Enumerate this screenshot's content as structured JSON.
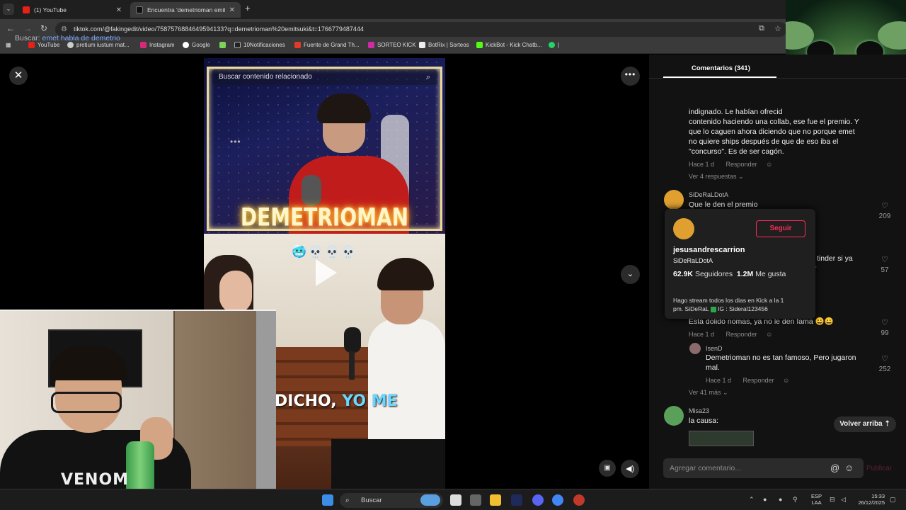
{
  "browser": {
    "tabs": [
      {
        "label": "(1) YouTube",
        "close": "✕"
      },
      {
        "label": "Encuentra 'demetrioman emits",
        "close": "✕"
      }
    ],
    "new_tab": "+",
    "url": "tiktok.com/@fakingedit/video/7587576884649594133?q=demetrioman%20emitsuki&t=1766779487444",
    "bookmarks": [
      "YouTube",
      "pretium iustum mat...",
      "Instagram",
      "Google",
      "10Notificaciones",
      "Fuente de Grand Th...",
      "SORTEO KICK",
      "BotRix | Sorteos",
      "KickBot - Kick Chatb..."
    ]
  },
  "video": {
    "search_placeholder": "Buscar contenido relacionado",
    "top_caption": "DEMETRIOMAN",
    "emoji_row": "🥶💀💀💀",
    "subtitle_white": "DICHO, ",
    "subtitle_highlight": "YO ME"
  },
  "webcam": {
    "shirt_text": "VENOM"
  },
  "comments": {
    "tab_title": "Comentarios (341)",
    "search_label": "Buscar:",
    "search_query": "emet habla de demetrio",
    "c1": {
      "text": "indignado. Le habían ofrecid contenido haciendo una collab, ese fue el premio. Y que lo caguen ahora diciendo que no porque emet no quiere ships después de que de eso iba el \"concurso\". Es de ser cagón.",
      "lines": [
        "indignado. Le habían ofrecid",
        "contenido haciendo una collab, ese fue el premio. Y",
        "que lo caguen ahora diciendo que no porque emet",
        "no quiere ships después de que de eso iba el",
        "\"concurso\". Es de ser cagón."
      ],
      "time": "Hace 1 d",
      "reply": "Responder",
      "view_replies": "Ver 4 respuestas ⌄"
    },
    "c2": {
      "user": "SiDeRaLDotA",
      "text": "Que le den el premio",
      "likes": "209"
    },
    "c3": {
      "partial_line1": "tinder si ya",
      "partial_line2": "r",
      "likes": "57"
    },
    "c4": {
      "text": "Esta dolido nomas, ya no le den fama 😀😀",
      "time": "Hace 1 d",
      "reply": "Responder",
      "likes": "99"
    },
    "c5": {
      "user": "IsenD",
      "lines": [
        "Demetrioman no es tan famoso, Pero jugaron",
        "mal."
      ],
      "time": "Hace 1 d",
      "reply": "Responder",
      "likes": "252",
      "view_more": "Ver 41 más ⌄"
    },
    "c6": {
      "user": "Misa23",
      "text": "la causa:"
    },
    "back_to_top": "Volver arriba ⇡",
    "add_placeholder": "Agregar comentario...",
    "publish": "Publicar"
  },
  "profile_popup": {
    "name": "jesusandrescarrion",
    "handle": "SiDeRaLDotA",
    "follow": "Seguir",
    "followers_count": "62.9K",
    "followers_label": "Seguidores",
    "likes_count": "1.2M",
    "likes_label": "Me gusta",
    "bio_line1": "Hago stream todos los dias en Kick a la 1",
    "bio_line2_a": "pm. SiDeRaL",
    "bio_line2_b": "IG : Sideral123456"
  },
  "taskbar": {
    "search": "Buscar",
    "lang_line1": "ESP",
    "lang_line2": "LAA",
    "time": "15:33",
    "date": "26/12/2025"
  },
  "colors": {
    "accent_red": "#fe2c55",
    "link_blue": "#7aa9ff",
    "panel_bg": "#121212"
  },
  "icons": [
    "close-icon",
    "more-icon",
    "chevron-down-icon",
    "volume-icon",
    "pip-icon",
    "search-icon",
    "heart-icon",
    "at-icon",
    "emoji-icon",
    "play-icon"
  ]
}
